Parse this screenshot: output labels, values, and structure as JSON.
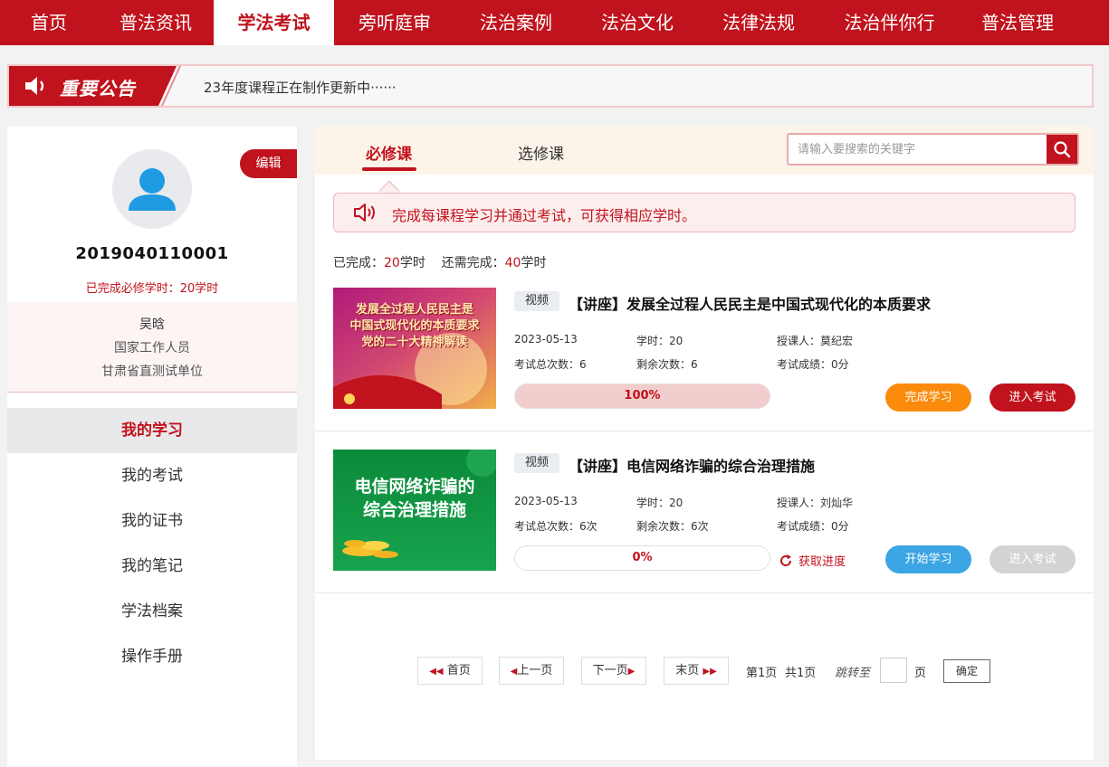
{
  "nav": {
    "items": [
      {
        "label": "首页",
        "active": false
      },
      {
        "label": "普法资讯",
        "active": false
      },
      {
        "label": "学法考试",
        "active": true
      },
      {
        "label": "旁听庭审",
        "active": false
      },
      {
        "label": "法治案例",
        "active": false
      },
      {
        "label": "法治文化",
        "active": false
      },
      {
        "label": "法律法规",
        "active": false
      },
      {
        "label": "法治伴你行",
        "active": false
      },
      {
        "label": "普法管理",
        "active": false
      }
    ]
  },
  "notice": {
    "title": "重要公告",
    "text": "23年度课程正在制作更新中······"
  },
  "profile": {
    "edit_label": "编辑",
    "user_id": "2019040110001",
    "hours_done": "已完成必修学时：20学时",
    "name": "吴晗",
    "role": "国家工作人员",
    "unit": "甘肃省直测试单位"
  },
  "menu": {
    "items": [
      {
        "label": "我的学习",
        "active": true
      },
      {
        "label": "我的考试",
        "active": false
      },
      {
        "label": "我的证书",
        "active": false
      },
      {
        "label": "我的笔记",
        "active": false
      },
      {
        "label": "学法档案",
        "active": false
      },
      {
        "label": "操作手册",
        "active": false
      }
    ]
  },
  "tabs": {
    "required": "必修课",
    "elective": "选修课"
  },
  "search": {
    "placeholder": "请输入要搜索的关键字"
  },
  "tip": {
    "text": "完成每课程学习并通过考试，可获得相应学时。"
  },
  "summary": {
    "done_label": "已完成：",
    "done_value": "20",
    "done_unit": "学时",
    "remaining_label": "还需完成：",
    "remaining_value": "40",
    "remaining_unit": "学时"
  },
  "courses": [
    {
      "type": "视频",
      "title": "【讲座】发展全过程人民民主是中国式现代化的本质要求",
      "thumb_text": [
        "发展全过程人民民主是",
        "中国式现代化的本质要求",
        "党的二十大精神解读"
      ],
      "date": "2023-05-13",
      "hours": "学时：20",
      "teacher": "授课人：莫纪宏",
      "exam_total": "考试总次数：6",
      "exam_left": "剩余次数：6",
      "exam_score": "考试成绩：0分",
      "progress": 100,
      "progress_text": "100%",
      "primary_btn": "完成学习",
      "exam_btn": "进入考试"
    },
    {
      "type": "视频",
      "title": "【讲座】电信网络诈骗的综合治理措施",
      "thumb_text": [
        "电信网络诈骗的",
        "综合治理措施"
      ],
      "date": "2023-05-13",
      "hours": "学时：20",
      "teacher": "授课人：刘灿华",
      "exam_total": "考试总次数：6次",
      "exam_left": "剩余次数：6次",
      "exam_score": "考试成绩：0分",
      "progress": 0,
      "progress_text": "0%",
      "refresh_label": "获取进度",
      "primary_btn": "开始学习",
      "exam_btn": "进入考试"
    }
  ],
  "pager": {
    "first": "首页",
    "prev": "上一页",
    "next": "下一页",
    "last": "末页",
    "current": "第1页",
    "total": "共1页",
    "goto_label": "跳转至",
    "page_unit": "页",
    "confirm": "确定"
  },
  "colors": {
    "brand_red": "#c0131d",
    "orange": "#fa8b0c",
    "blue": "#3ca5e3",
    "disabled_gray": "#d3d3d3"
  }
}
